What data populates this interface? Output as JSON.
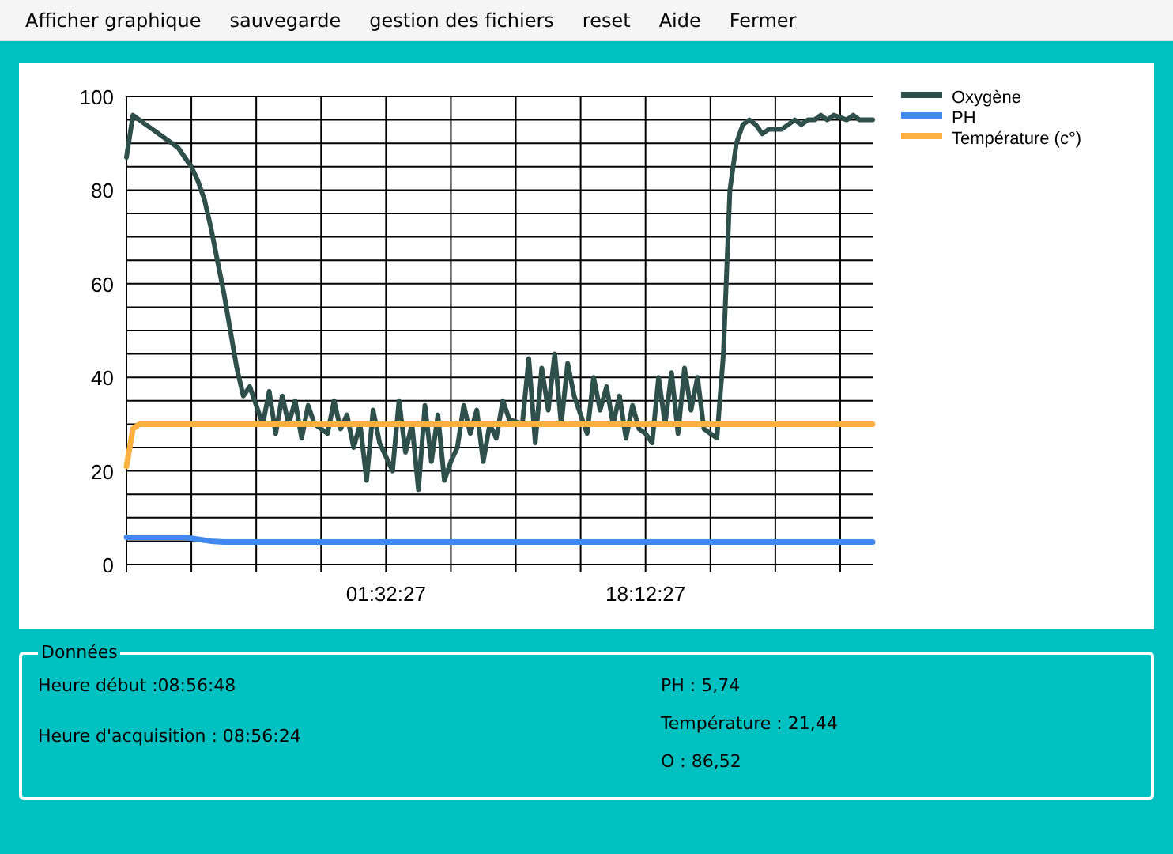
{
  "menu": [
    {
      "label": "Afficher graphique"
    },
    {
      "label": "sauvegarde"
    },
    {
      "label": "gestion des fichiers"
    },
    {
      "label": "reset"
    },
    {
      "label": "Aide"
    },
    {
      "label": "Fermer"
    }
  ],
  "chart": {
    "chart_data": {
      "type": "line",
      "grid": true,
      "legend": true,
      "ylim": [
        0,
        100
      ],
      "yticks": [
        0,
        20,
        40,
        60,
        80,
        100
      ],
      "categories": [
        null,
        null,
        null,
        null,
        null,
        null,
        null,
        null,
        null,
        null,
        null,
        null,
        null,
        null,
        null,
        null,
        null,
        null,
        null,
        null,
        null,
        null,
        null,
        null,
        null,
        null,
        null,
        null,
        null,
        null,
        null,
        null,
        null,
        null,
        null,
        null,
        null,
        null,
        null,
        null,
        "01:32:27",
        null,
        null,
        null,
        null,
        null,
        null,
        null,
        null,
        null,
        null,
        null,
        null,
        null,
        null,
        null,
        null,
        null,
        null,
        null,
        null,
        null,
        null,
        null,
        null,
        null,
        null,
        null,
        null,
        null,
        null,
        null,
        null,
        null,
        null,
        null,
        null,
        null,
        null,
        null,
        "18:12:27",
        null,
        null,
        null,
        null,
        null,
        null,
        null,
        null,
        null,
        null,
        null,
        null,
        null,
        null,
        null,
        null,
        null,
        null,
        null,
        null,
        null,
        null,
        null,
        null,
        null,
        null,
        null,
        null,
        null,
        null,
        null,
        null,
        null,
        null,
        null
      ],
      "series": [
        {
          "name": "Oxygène",
          "color": "#2f4f4a",
          "values": [
            87,
            96,
            95,
            94,
            93,
            92,
            91,
            90,
            89,
            87,
            85,
            82,
            78,
            72,
            65,
            58,
            50,
            42,
            36,
            38,
            34,
            30,
            37,
            28,
            36,
            30,
            35,
            27,
            34,
            30,
            29,
            28,
            35,
            29,
            32,
            25,
            30,
            18,
            33,
            26,
            23,
            20,
            35,
            24,
            30,
            16,
            34,
            22,
            32,
            18,
            22,
            25,
            34,
            28,
            33,
            22,
            30,
            27,
            35,
            31,
            30.5,
            30,
            44,
            26,
            42,
            33,
            45,
            30,
            43,
            36,
            32,
            28,
            40,
            33,
            38,
            30,
            36,
            27,
            34,
            29,
            28,
            26,
            40,
            30,
            41,
            28,
            42,
            33,
            40,
            29,
            28,
            27,
            45,
            80,
            90,
            94,
            95,
            94,
            92,
            93,
            93,
            93,
            94,
            95,
            94,
            95,
            95,
            96,
            95,
            96,
            95.5,
            95,
            96,
            95,
            95,
            95
          ]
        },
        {
          "name": "PH",
          "color": "#4189f0",
          "values": [
            5.8,
            5.8,
            5.8,
            5.8,
            5.8,
            5.8,
            5.8,
            5.8,
            5.8,
            5.8,
            5.6,
            5.4,
            5.2,
            5,
            4.9,
            4.8,
            4.8,
            4.8,
            4.8,
            4.8,
            4.8,
            4.8,
            4.8,
            4.8,
            4.8,
            4.8,
            4.8,
            4.8,
            4.8,
            4.8,
            4.8,
            4.8,
            4.8,
            4.8,
            4.8,
            4.8,
            4.8,
            4.8,
            4.8,
            4.8,
            4.8,
            4.8,
            4.8,
            4.8,
            4.8,
            4.8,
            4.8,
            4.8,
            4.8,
            4.8,
            4.8,
            4.8,
            4.8,
            4.8,
            4.8,
            4.8,
            4.8,
            4.8,
            4.8,
            4.8,
            4.8,
            4.8,
            4.8,
            4.8,
            4.8,
            4.8,
            4.8,
            4.8,
            4.8,
            4.8,
            4.8,
            4.8,
            4.8,
            4.8,
            4.8,
            4.8,
            4.8,
            4.8,
            4.8,
            4.8,
            4.8,
            4.8,
            4.8,
            4.8,
            4.8,
            4.8,
            4.8,
            4.8,
            4.8,
            4.8,
            4.8,
            4.8,
            4.8,
            4.8,
            4.8,
            4.8,
            4.8,
            4.8,
            4.8,
            4.8,
            4.8,
            4.8,
            4.8,
            4.8,
            4.8,
            4.8,
            4.8,
            4.8,
            4.8,
            4.8,
            4.8,
            4.8,
            4.8,
            4.8,
            4.8,
            4.8
          ]
        },
        {
          "name": "Température (c°)",
          "color": "#fbb040",
          "values": [
            21,
            29,
            30,
            30,
            30,
            30,
            30,
            30,
            30,
            30,
            30,
            30,
            30,
            30,
            30,
            30,
            30,
            30,
            30,
            30,
            30,
            30,
            30,
            30,
            30,
            30,
            30,
            30,
            30,
            30,
            30,
            30,
            30,
            30,
            30,
            30,
            30,
            30,
            30,
            30,
            30,
            30,
            30,
            30,
            30,
            30,
            30,
            30,
            30,
            30,
            30,
            30,
            30,
            30,
            30,
            30,
            30,
            30,
            30,
            30,
            30,
            30,
            30,
            30,
            30,
            30,
            30,
            30,
            30,
            30,
            30,
            30,
            30,
            30,
            30,
            30,
            30,
            30,
            30,
            30,
            30,
            30,
            30,
            30,
            30,
            30,
            30,
            30,
            30,
            30,
            30,
            30,
            30,
            30,
            30,
            30,
            30,
            30,
            30,
            30,
            30,
            30,
            30,
            30,
            30,
            30,
            30,
            30,
            30,
            30,
            30,
            30,
            30,
            30,
            30,
            30
          ]
        }
      ]
    }
  },
  "data_panel": {
    "title": "Données",
    "left": [
      "Heure début :08:56:48",
      "Heure d'acquisition : 08:56:24"
    ],
    "right": [
      "PH : 5,74",
      "Température : 21,44",
      "O : 86,52"
    ]
  }
}
